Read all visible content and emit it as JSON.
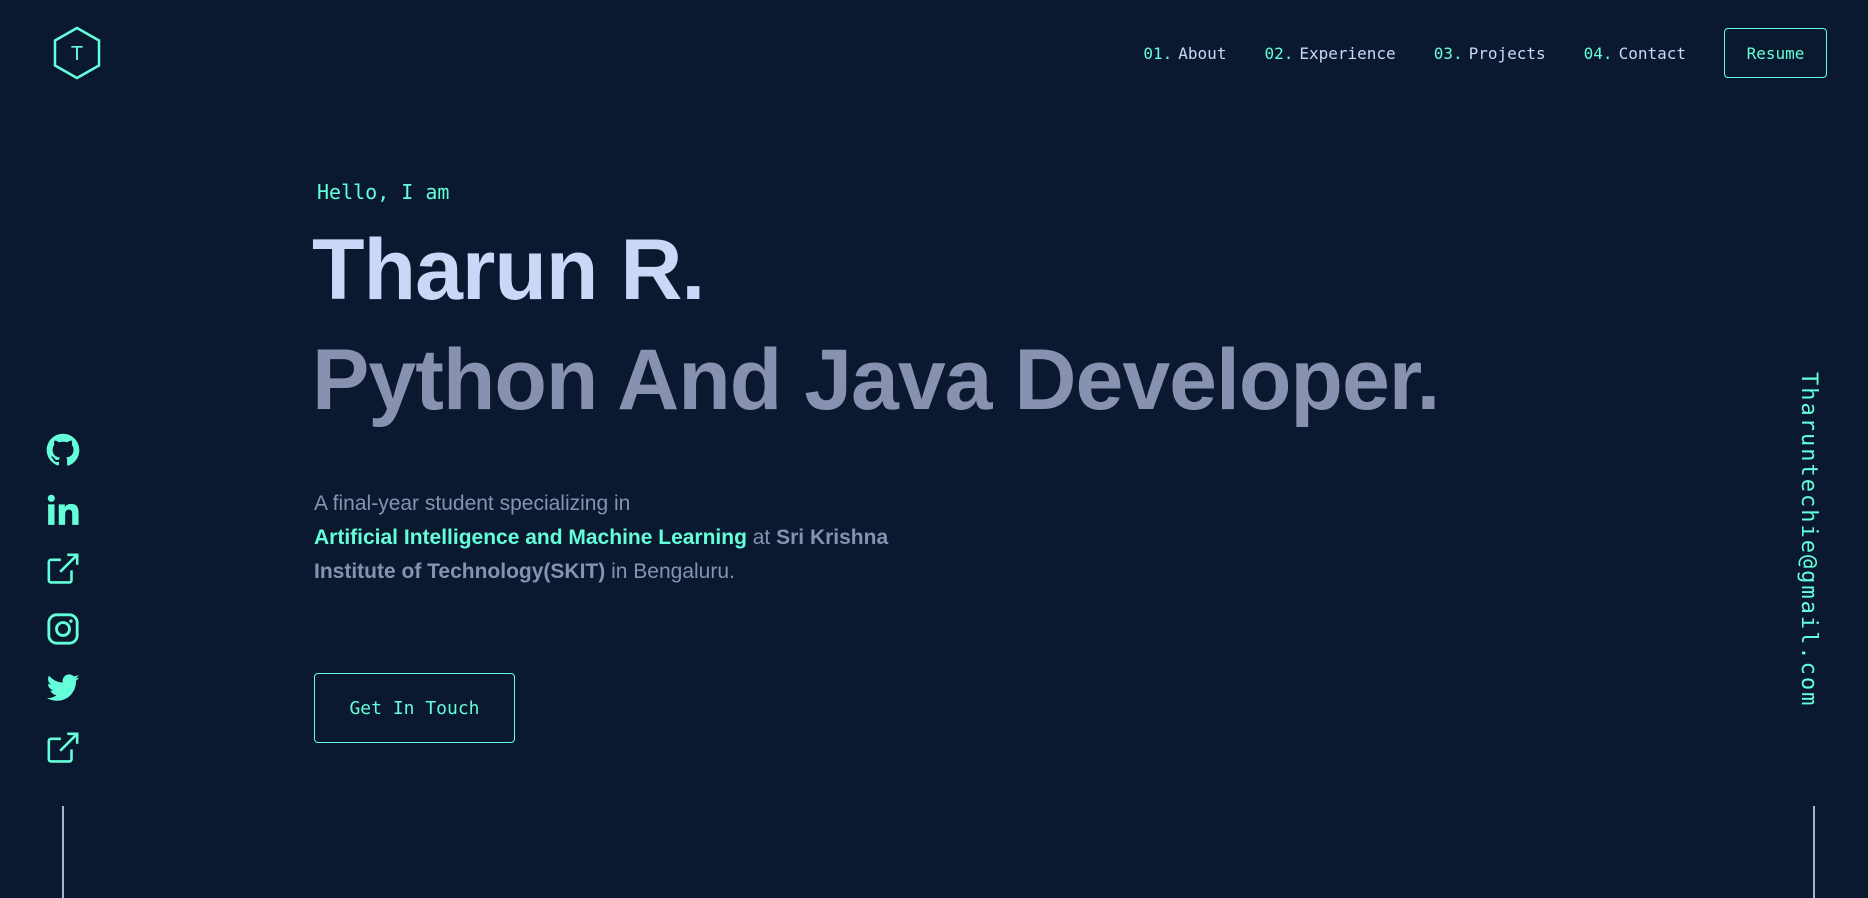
{
  "logo": {
    "letter": "T",
    "icon": "hexagon-logo-icon"
  },
  "nav": {
    "items": [
      {
        "num": "01.",
        "label": "About"
      },
      {
        "num": "02.",
        "label": "Experience"
      },
      {
        "num": "03.",
        "label": "Projects"
      },
      {
        "num": "04.",
        "label": "Contact"
      }
    ],
    "resume_label": "Resume"
  },
  "hero": {
    "greeting": "Hello, I am",
    "name": "Tharun R.",
    "role": "Python And Java Developer.",
    "intro": {
      "line1": "A final-year student specializing in",
      "field": "Artificial Intelligence and Machine Learning",
      "at": " at ",
      "college": "Sri Krishna Institute of Technology(SKIT)",
      "location": " in Bengaluru."
    },
    "cta_label": "Get In Touch"
  },
  "social": {
    "icons": [
      "github-icon",
      "linkedin-icon",
      "external-link-icon",
      "instagram-icon",
      "twitter-icon",
      "external-link-icon"
    ]
  },
  "email": "Tharuntechie@gmail.com",
  "colors": {
    "background": "#0a192f",
    "accent": "#64ffda",
    "heading": "#ccd6f6",
    "muted": "#8892b0"
  }
}
